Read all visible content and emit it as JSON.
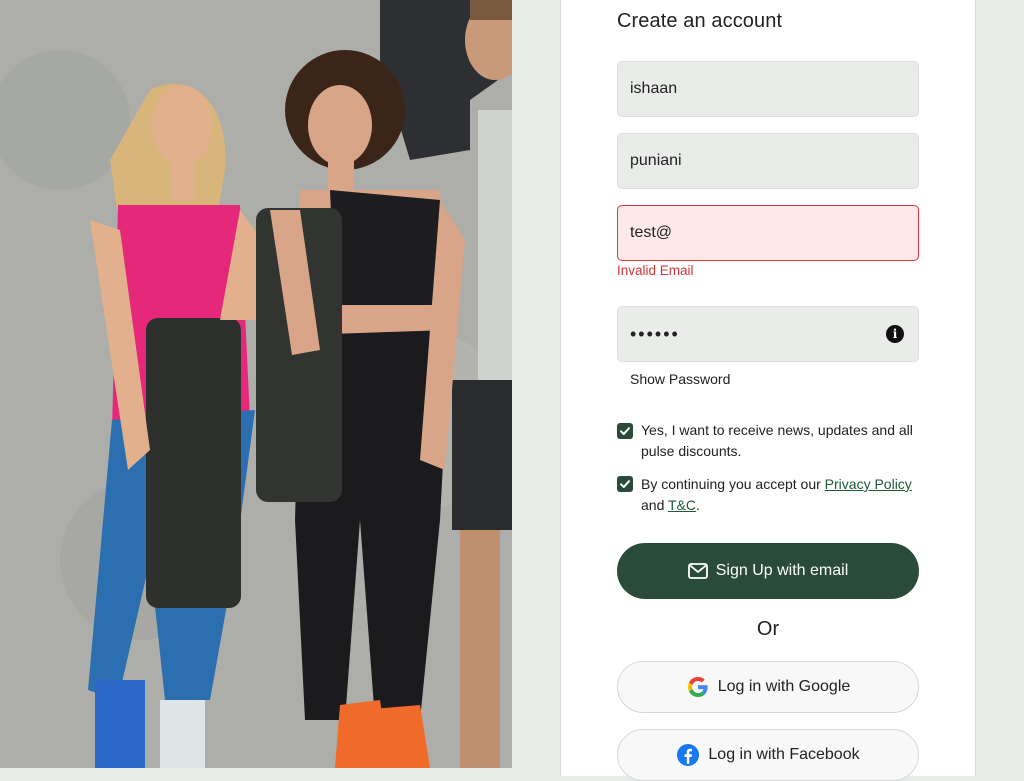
{
  "form": {
    "title": "Create an account",
    "first_name": "ishaan",
    "last_name": "puniani",
    "email": "test@",
    "email_error": "Invalid Email",
    "password_mask": "••••••",
    "show_password_label": "Show Password",
    "checkbox_news": {
      "checked": true,
      "label": "Yes, I want to receive news, updates and all pulse discounts."
    },
    "checkbox_terms": {
      "checked": true,
      "prefix": "By continuing you accept our ",
      "privacy_link": "Privacy Policy",
      "middle": " and ",
      "tc_link": "T&C",
      "suffix": "."
    },
    "signup_button": "Sign Up with email",
    "or_text": "Or",
    "google_button": "Log in with Google",
    "facebook_button": "Log in with Facebook"
  },
  "colors": {
    "primary": "#2a4a3a",
    "error": "#d13438",
    "error_bg": "#fde9e9",
    "field_bg": "#e9ece9",
    "page_bg": "#e9edea"
  },
  "icons": {
    "email": "envelope-icon",
    "info": "info-icon",
    "google": "google-logo-icon",
    "facebook": "facebook-logo-icon",
    "check": "checkmark-icon"
  }
}
